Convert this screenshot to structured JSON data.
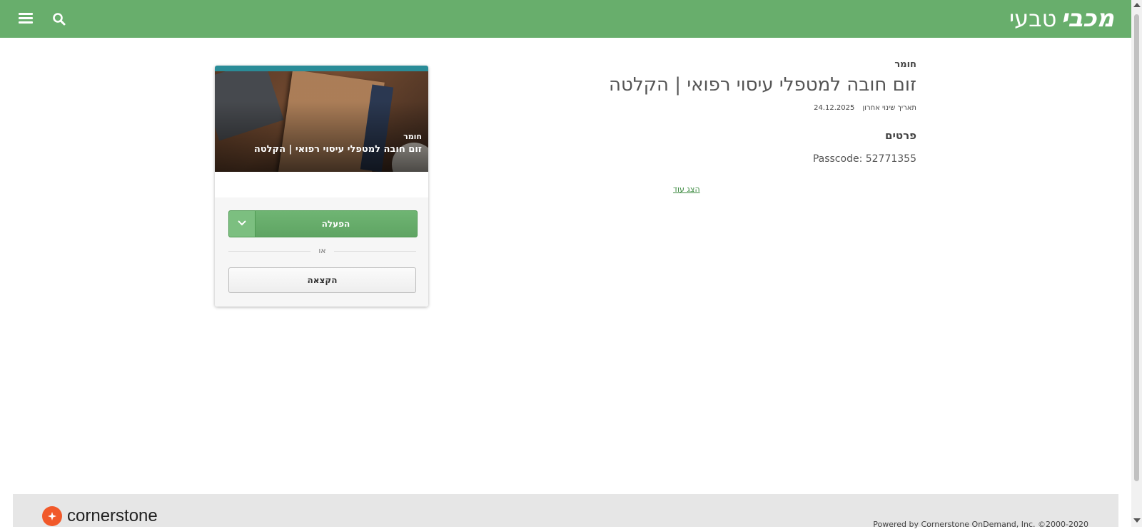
{
  "header": {
    "logo_main": "מכבי",
    "logo_sub": "טבעי"
  },
  "details": {
    "type_label": "חומר",
    "title": "זום חובה למטפלי עיסוי רפואי | הקלטה",
    "modified_label": "תאריך שינוי אחרון",
    "modified_date": "24.12.2025",
    "section_heading": "פרטים",
    "passcode": "Passcode: 52771355",
    "show_more": "הצג עוד"
  },
  "card": {
    "overlay_type": "חומר",
    "overlay_title": "זום חובה למטפלי עיסוי רפואי | הקלטה",
    "launch_label": "הפעלה",
    "or_label": "או",
    "assign_label": "הקצאה"
  },
  "footer": {
    "brand": "cornerstone",
    "powered_by": "Powered by Cornerstone OnDemand, Inc. ©2000-2020"
  },
  "colors": {
    "header_green": "#68ae6c",
    "launch_green": "#5fa463",
    "card_accent": "#2a8c98",
    "cornerstone_orange": "#f1592a"
  }
}
